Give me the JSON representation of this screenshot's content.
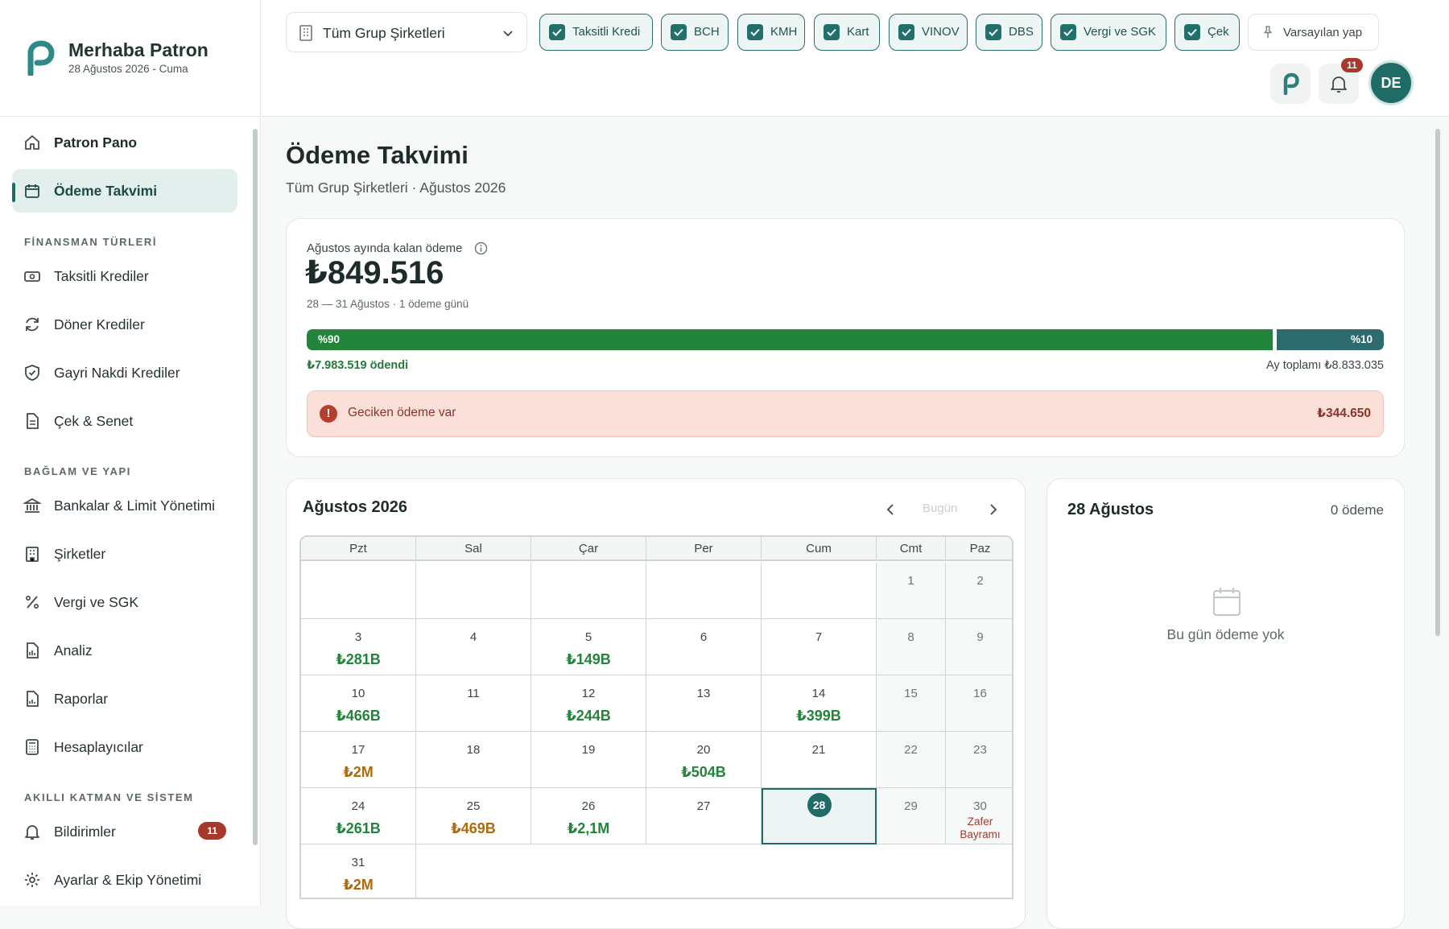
{
  "brand": {
    "title": "Merhaba Patron",
    "date": "28 Ağustos 2026 - Cuma"
  },
  "nav": {
    "patron_pano": "Patron Pano",
    "odeme_takvimi": "Ödeme Takvimi",
    "section_finansman": "FİNANSMAN TÜRLERİ",
    "taksitli": "Taksitli Krediler",
    "doner": "Döner Krediler",
    "gayri_nakdi": "Gayri Nakdi Krediler",
    "cek_senet": "Çek & Senet",
    "section_baglam": "BAĞLAM VE YAPI",
    "bankalar": "Bankalar & Limit Yönetimi",
    "sirketler": "Şirketler",
    "vergi": "Vergi ve SGK",
    "analiz": "Analiz",
    "raporlar": "Raporlar",
    "hesaplayicilar": "Hesaplayıcılar",
    "section_akilli": "AKILLI KATMAN VE SİSTEM",
    "bildirimler": "Bildirimler",
    "bildirimler_count": "11",
    "ayarlar": "Ayarlar & Ekip Yönetimi"
  },
  "topbar": {
    "company_select": "Tüm Grup Şirketleri",
    "filters": [
      "Taksitli Kredi",
      "BCH",
      "KMH",
      "Kart",
      "VINOV",
      "DBS",
      "Vergi ve SGK",
      "Çek"
    ],
    "default_btn": "Varsayılan yap",
    "notification_count": "11",
    "avatar": "DE"
  },
  "page": {
    "title": "Ödeme Takvimi",
    "subtitle": "Tüm Grup Şirketleri · Ağustos 2026"
  },
  "summary": {
    "label": "Ağustos ayında kalan ödeme",
    "amount": "₺849.516",
    "range": "28 — 31 Ağustos · 1 ödeme günü",
    "paid_pct_label": "%90",
    "paid_fraction": 0.9,
    "remaining_pct_label": "%10",
    "paid": "₺7.983.519 ödendi",
    "month_total": "Ay toplamı ₺8.833.035",
    "alert_text": "Geciken ödeme var",
    "alert_amount": "₺344.650"
  },
  "calendar": {
    "title": "Ağustos 2026",
    "today_btn": "Bugün",
    "weekdays": [
      "Pzt",
      "Sal",
      "Çar",
      "Per",
      "Cum",
      "Cmt",
      "Paz"
    ],
    "days": [
      {
        "d": "1",
        "amt": "",
        "tone": ""
      },
      {
        "d": "2",
        "amt": "",
        "tone": ""
      },
      {
        "d": "3",
        "amt": "₺281B",
        "tone": "green"
      },
      {
        "d": "4",
        "amt": "",
        "tone": ""
      },
      {
        "d": "5",
        "amt": "₺149B",
        "tone": "green"
      },
      {
        "d": "6",
        "amt": "",
        "tone": ""
      },
      {
        "d": "7",
        "amt": "",
        "tone": ""
      },
      {
        "d": "8",
        "amt": "",
        "tone": ""
      },
      {
        "d": "9",
        "amt": "",
        "tone": ""
      },
      {
        "d": "10",
        "amt": "₺466B",
        "tone": "green"
      },
      {
        "d": "11",
        "amt": "",
        "tone": ""
      },
      {
        "d": "12",
        "amt": "₺244B",
        "tone": "green"
      },
      {
        "d": "13",
        "amt": "",
        "tone": ""
      },
      {
        "d": "14",
        "amt": "₺399B",
        "tone": "green"
      },
      {
        "d": "15",
        "amt": "",
        "tone": ""
      },
      {
        "d": "16",
        "amt": "",
        "tone": ""
      },
      {
        "d": "17",
        "amt": "₺2M",
        "tone": "orange"
      },
      {
        "d": "18",
        "amt": "",
        "tone": ""
      },
      {
        "d": "19",
        "amt": "",
        "tone": ""
      },
      {
        "d": "20",
        "amt": "₺504B",
        "tone": "green"
      },
      {
        "d": "21",
        "amt": "",
        "tone": ""
      },
      {
        "d": "22",
        "amt": "",
        "tone": ""
      },
      {
        "d": "23",
        "amt": "",
        "tone": ""
      },
      {
        "d": "24",
        "amt": "₺261B",
        "tone": "green"
      },
      {
        "d": "25",
        "amt": "₺469B",
        "tone": "orange"
      },
      {
        "d": "26",
        "amt": "₺2,1M",
        "tone": "green"
      },
      {
        "d": "27",
        "amt": "",
        "tone": ""
      },
      {
        "d": "28",
        "amt": "",
        "tone": "",
        "selected": true
      },
      {
        "d": "29",
        "amt": "",
        "tone": ""
      },
      {
        "d": "30",
        "amt": "",
        "tone": "",
        "holiday": "Zafer Bayramı"
      },
      {
        "d": "31",
        "amt": "₺2M",
        "tone": "orange"
      }
    ]
  },
  "day_panel": {
    "title": "28 Ağustos",
    "count": "0 ödeme",
    "empty": "Bu gün ödeme yok"
  }
}
